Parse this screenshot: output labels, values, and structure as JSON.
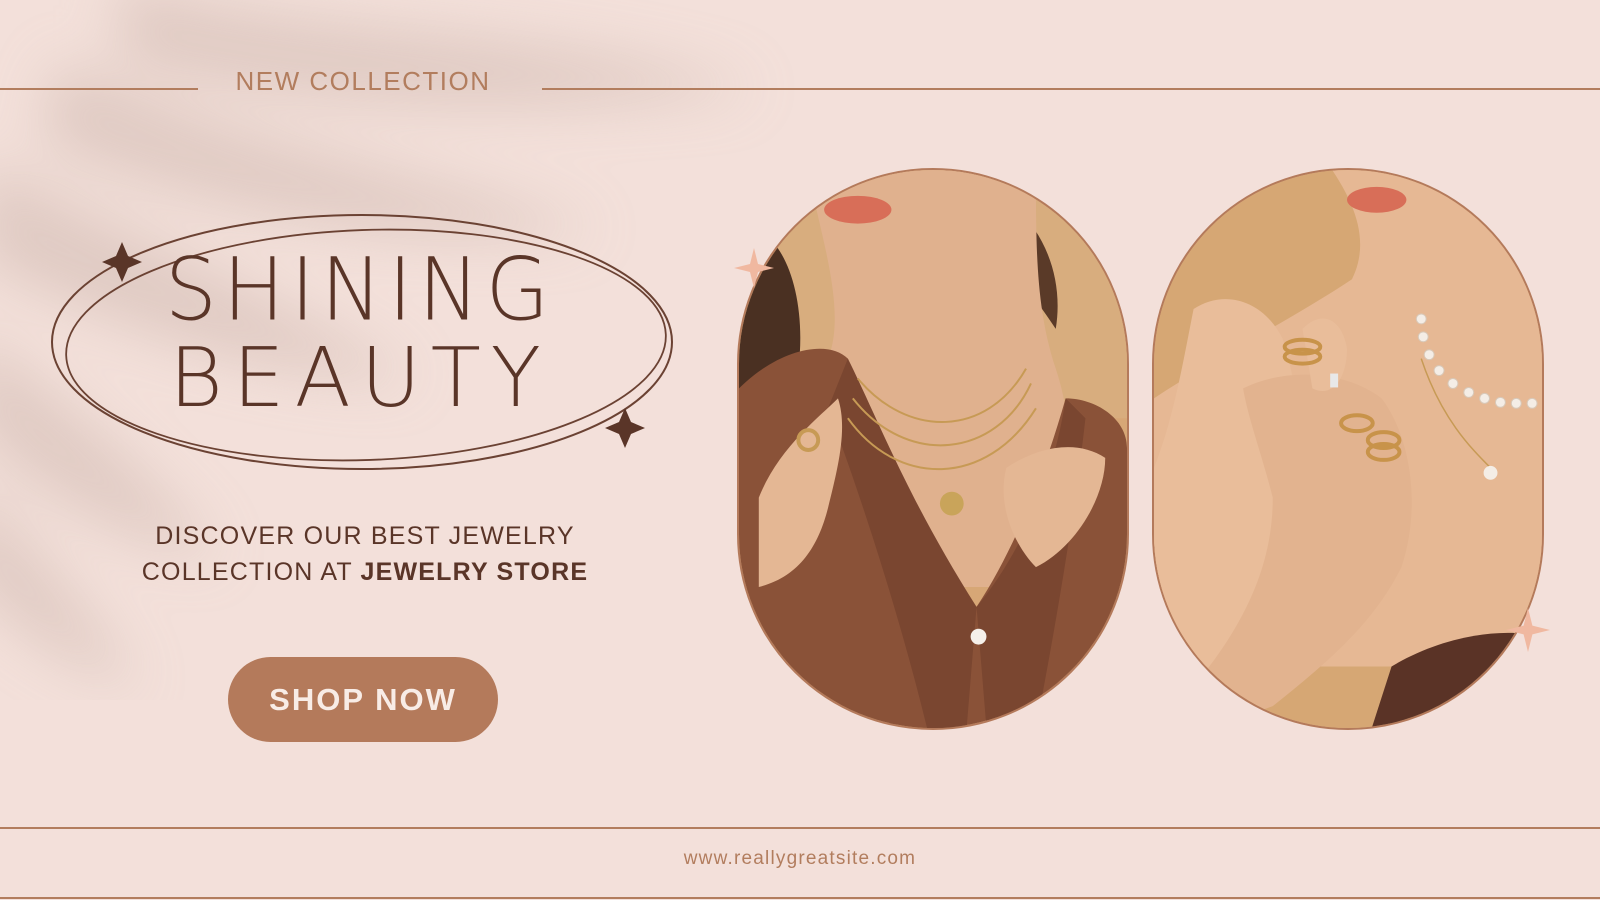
{
  "banner": {
    "eyebrow": "NEW COLLECTION",
    "title_line1": "SHINING",
    "title_line2": "BEAUTY",
    "tagline_line1": "DISCOVER OUR BEST JEWELRY",
    "tagline_line2_prefix": "COLLECTION AT",
    "tagline_line2_brand": "JEWELRY STORE",
    "cta_label": "SHOP NOW",
    "website": "www.reallygreatsite.com"
  },
  "photos": [
    {
      "subject": "model in brown shirt wearing layered gold necklaces and rings"
    },
    {
      "subject": "model with crossed hands wearing stacked gold rings and pearl necklace"
    }
  ],
  "colors": {
    "background": "#f3e0da",
    "accent": "#b47a5b",
    "dark_text": "#5a3528",
    "sparkle_light": "#f0b8a0"
  }
}
